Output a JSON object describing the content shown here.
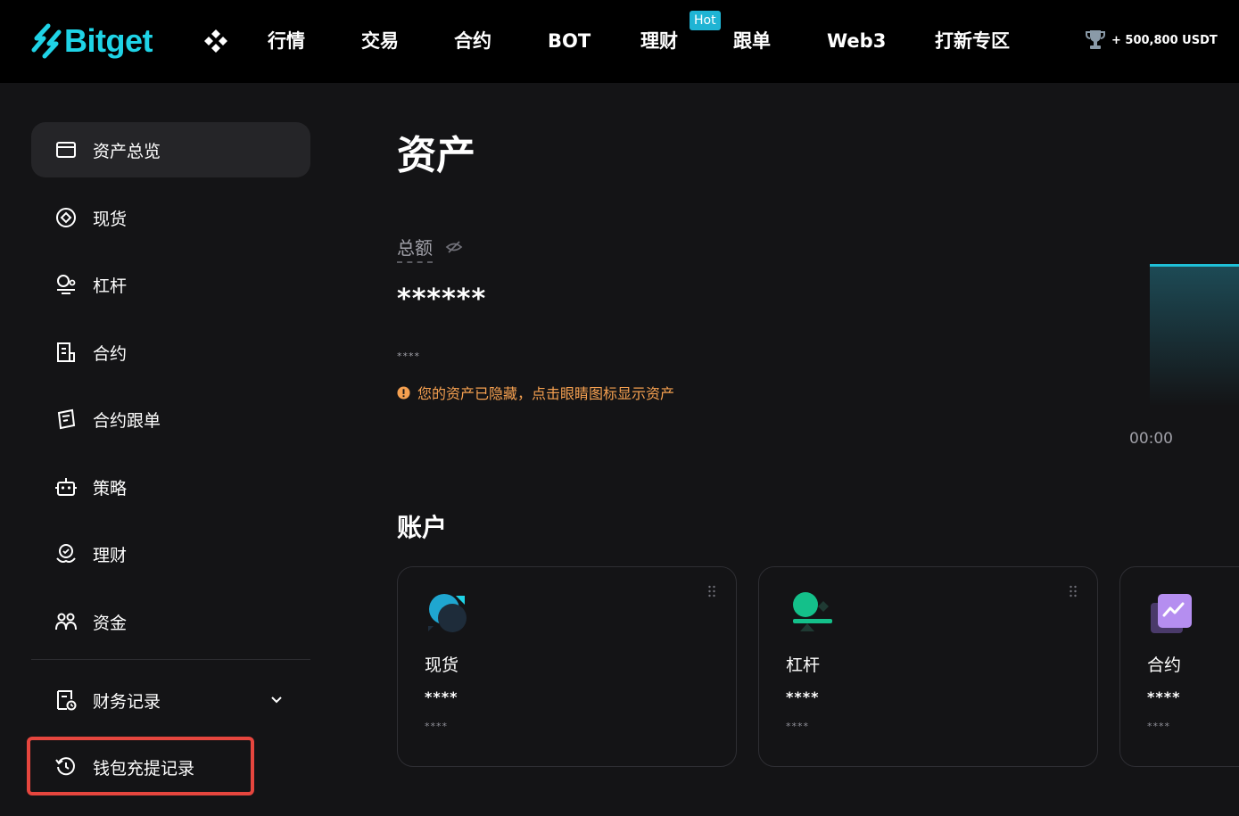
{
  "brand": {
    "name": "Bitget",
    "accent": "#1fd3e6"
  },
  "nav": {
    "items": [
      "行情",
      "交易",
      "合约",
      "BOT",
      "理财",
      "跟单",
      "Web3",
      "打新专区"
    ],
    "hot_badge": "Hot",
    "reward": "+ 500,800 USDT"
  },
  "sidebar": {
    "items": [
      {
        "label": "资产总览",
        "icon": "wallet-icon"
      },
      {
        "label": "现货",
        "icon": "spot-icon"
      },
      {
        "label": "杠杆",
        "icon": "margin-icon"
      },
      {
        "label": "合约",
        "icon": "futures-icon"
      },
      {
        "label": "合约跟单",
        "icon": "copy-trade-icon"
      },
      {
        "label": "策略",
        "icon": "robot-icon"
      },
      {
        "label": "理财",
        "icon": "earn-icon"
      },
      {
        "label": "资金",
        "icon": "funding-icon"
      },
      {
        "label": "财务记录",
        "icon": "record-icon"
      },
      {
        "label": "钱包充提记录",
        "icon": "history-icon"
      }
    ]
  },
  "main": {
    "title": "资产",
    "total_label": "总额",
    "total_value": "******",
    "sub_value": "****",
    "notice": "您的资产已隐藏，点击眼睛图标显示资产",
    "chart_time": "00:00",
    "accounts_title": "账户",
    "cards": [
      {
        "name": "现货",
        "value": "****",
        "sub": "****"
      },
      {
        "name": "杠杆",
        "value": "****",
        "sub": "****"
      },
      {
        "name": "合约",
        "value": "****",
        "sub": "****"
      }
    ]
  },
  "colors": {
    "warning": "#f5a050",
    "highlight": "#e6463e",
    "hot": "#1fb4d4"
  }
}
